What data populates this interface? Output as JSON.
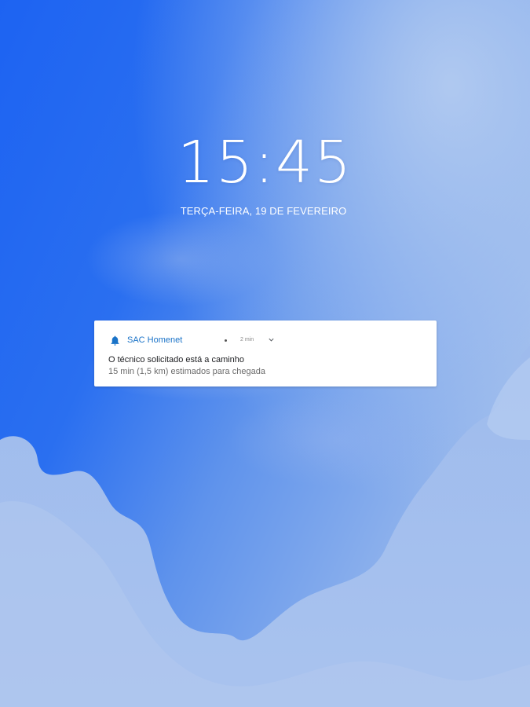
{
  "lockscreen": {
    "time": "15:45",
    "date": "TERÇA-FEIRA, 19 DE FEVEREIRO"
  },
  "notification": {
    "app_name": "SAC Homenet",
    "time": "2 min",
    "title": "O técnico solicitado está a caminho",
    "text": "15 min (1,5 km) estimados para chegada",
    "icon": "bell-icon",
    "expand_icon": "chevron-down-icon"
  },
  "colors": {
    "wallpaper_deep_blue": "#1f6bf0",
    "wallpaper_light_blue": "#a6c1ee",
    "app_accent": "#1a73c8",
    "notification_background": "#ffffff"
  }
}
